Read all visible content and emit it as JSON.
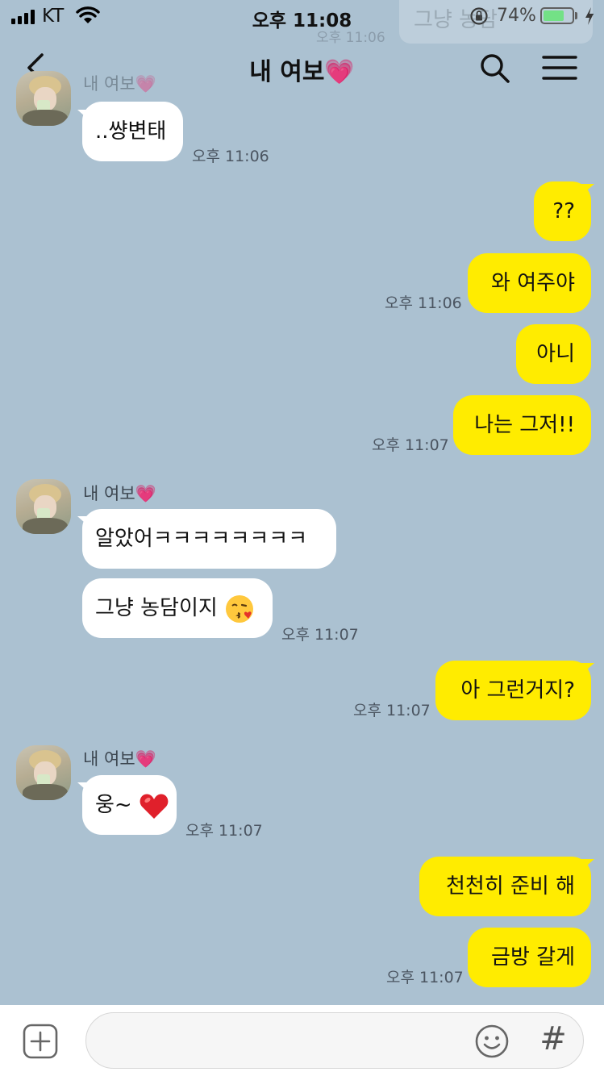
{
  "status_bar": {
    "carrier": "KT",
    "time": "오후 11:08",
    "battery_percent": "74%",
    "battery_level": 0.74
  },
  "ghost_preview": {
    "text": "그냥 농담",
    "time": "오후 11:06"
  },
  "header": {
    "title": "내 여보💗"
  },
  "messages": [
    {
      "sender": "내 여보💗",
      "text": "..썅변태",
      "time": "오후 11:06"
    },
    {
      "text": "??"
    },
    {
      "text": "와 여주야",
      "time": "오후 11:06"
    },
    {
      "text": "아니"
    },
    {
      "text": "나는 그저!!",
      "time": "오후 11:07"
    },
    {
      "sender": "내 여보💗",
      "text": "알았어ㅋㅋㅋㅋㅋㅋㅋㅋ"
    },
    {
      "text": "그냥 농담이지",
      "time": "오후 11:07"
    },
    {
      "text": "아 그런거지?",
      "time": "오후 11:07"
    },
    {
      "sender": "내 여보💗",
      "text": "웅~",
      "time": "오후 11:07"
    },
    {
      "text": "천천히 준비 해"
    },
    {
      "text": "금방 갈게",
      "time": "오후 11:07"
    }
  ],
  "icons": {
    "back": "chevron-left-icon",
    "search": "search-icon",
    "menu": "hamburger-menu-icon",
    "plus": "plus-square-icon",
    "emoji": "smiley-icon",
    "hash": "hash-icon",
    "kiss": "kissing-face-emoji",
    "heart": "red-heart-emoji"
  },
  "input": {
    "placeholder": "",
    "hash_glyph": "#"
  },
  "colors": {
    "chat_bg": "#abc1d1",
    "out_bubble": "#ffec00",
    "in_bubble": "#ffffff"
  }
}
